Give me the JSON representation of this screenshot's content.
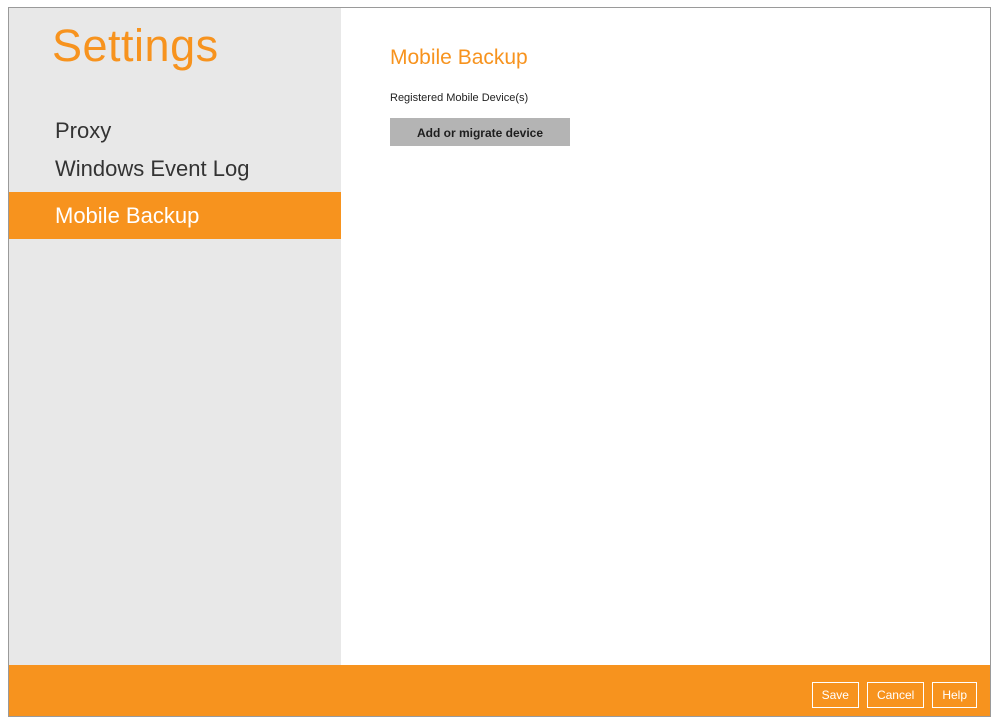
{
  "sidebar": {
    "title": "Settings",
    "items": [
      {
        "label": "Proxy",
        "active": false
      },
      {
        "label": "Windows Event Log",
        "active": false
      },
      {
        "label": "Mobile Backup",
        "active": true
      }
    ]
  },
  "main": {
    "title": "Mobile Backup",
    "section_label": "Registered Mobile Device(s)",
    "add_button_label": "Add or migrate device"
  },
  "footer": {
    "save_label": "Save",
    "cancel_label": "Cancel",
    "help_label": "Help"
  },
  "colors": {
    "accent": "#f7931e",
    "sidebar_bg": "#e8e8e8",
    "button_gray": "#b4b4b4"
  }
}
